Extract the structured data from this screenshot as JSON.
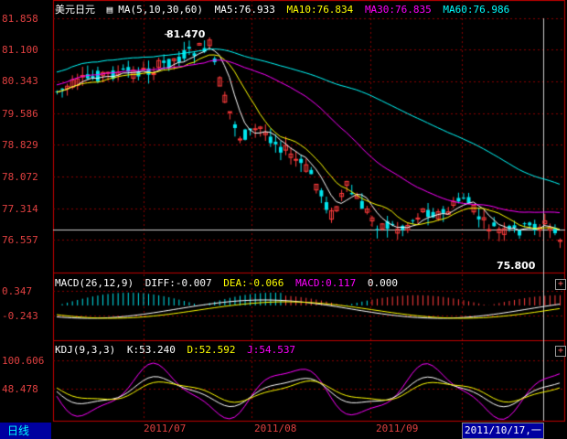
{
  "instrument": {
    "name": "美元日元"
  },
  "main_legend": {
    "ma_label": "MA(5,10,30,60)",
    "ma5": "MA5:76.933",
    "ma10": "MA10:76.834",
    "ma30": "MA30:76.835",
    "ma60": "MA60:76.986"
  },
  "price_axis": [
    "81.858",
    "81.100",
    "80.343",
    "79.586",
    "78.829",
    "78.072",
    "77.314",
    "76.557"
  ],
  "annotations": {
    "high": "81.470",
    "low": "75.800"
  },
  "macd_legend": {
    "label": "MACD(26,12,9)",
    "diff": "DIFF:-0.007",
    "dea": "DEA:-0.066",
    "macd": "MACD:0.117",
    "extra": "0.000"
  },
  "macd_axis": [
    "0.347",
    "-0.243"
  ],
  "kdj_legend": {
    "label": "KDJ(9,3,3)",
    "k": "K:53.240",
    "d": "D:52.592",
    "j": "J:54.537"
  },
  "kdj_axis": [
    "100.606",
    "48.478"
  ],
  "time_axis": [
    "2011/07",
    "2011/08",
    "2011/09"
  ],
  "period_label": "日线",
  "cursor_date": "2011/10/17,一",
  "buttons": {
    "plus": "+"
  },
  "colors": {
    "up": "#ff3c3c",
    "down": "#00e5ee",
    "ma5": "#ffffff",
    "ma10": "#ffff00",
    "ma30": "#ff00ff",
    "ma60": "#00ffff",
    "grid": "#8b0000"
  }
}
